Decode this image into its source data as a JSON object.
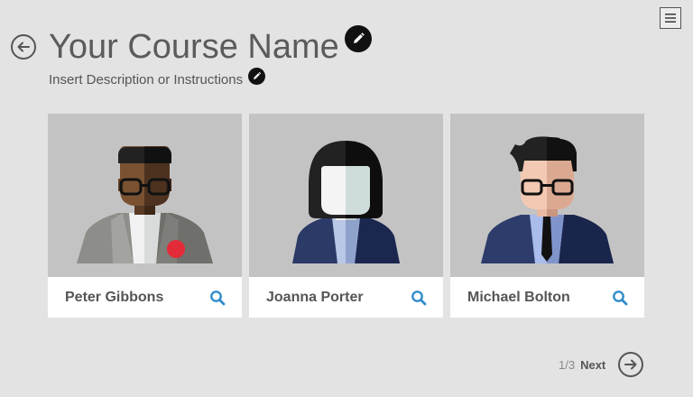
{
  "header": {
    "title": "Your Course Name",
    "description": "Insert Description or Instructions"
  },
  "icons": {
    "menu": "hamburger-menu-icon",
    "back": "arrow-left-icon",
    "edit": "pencil-icon",
    "search": "magnifier-icon",
    "next": "arrow-right-icon"
  },
  "cards": [
    {
      "name": "Peter Gibbons"
    },
    {
      "name": "Joanna Porter"
    },
    {
      "name": "Michael Bolton"
    }
  ],
  "pager": {
    "count": "1/3",
    "next_label": "Next"
  },
  "colors": {
    "background": "#e3e3e3",
    "card_image_bg": "#c3c3c3",
    "search_icon": "#2f8ccc",
    "text": "#555555"
  }
}
